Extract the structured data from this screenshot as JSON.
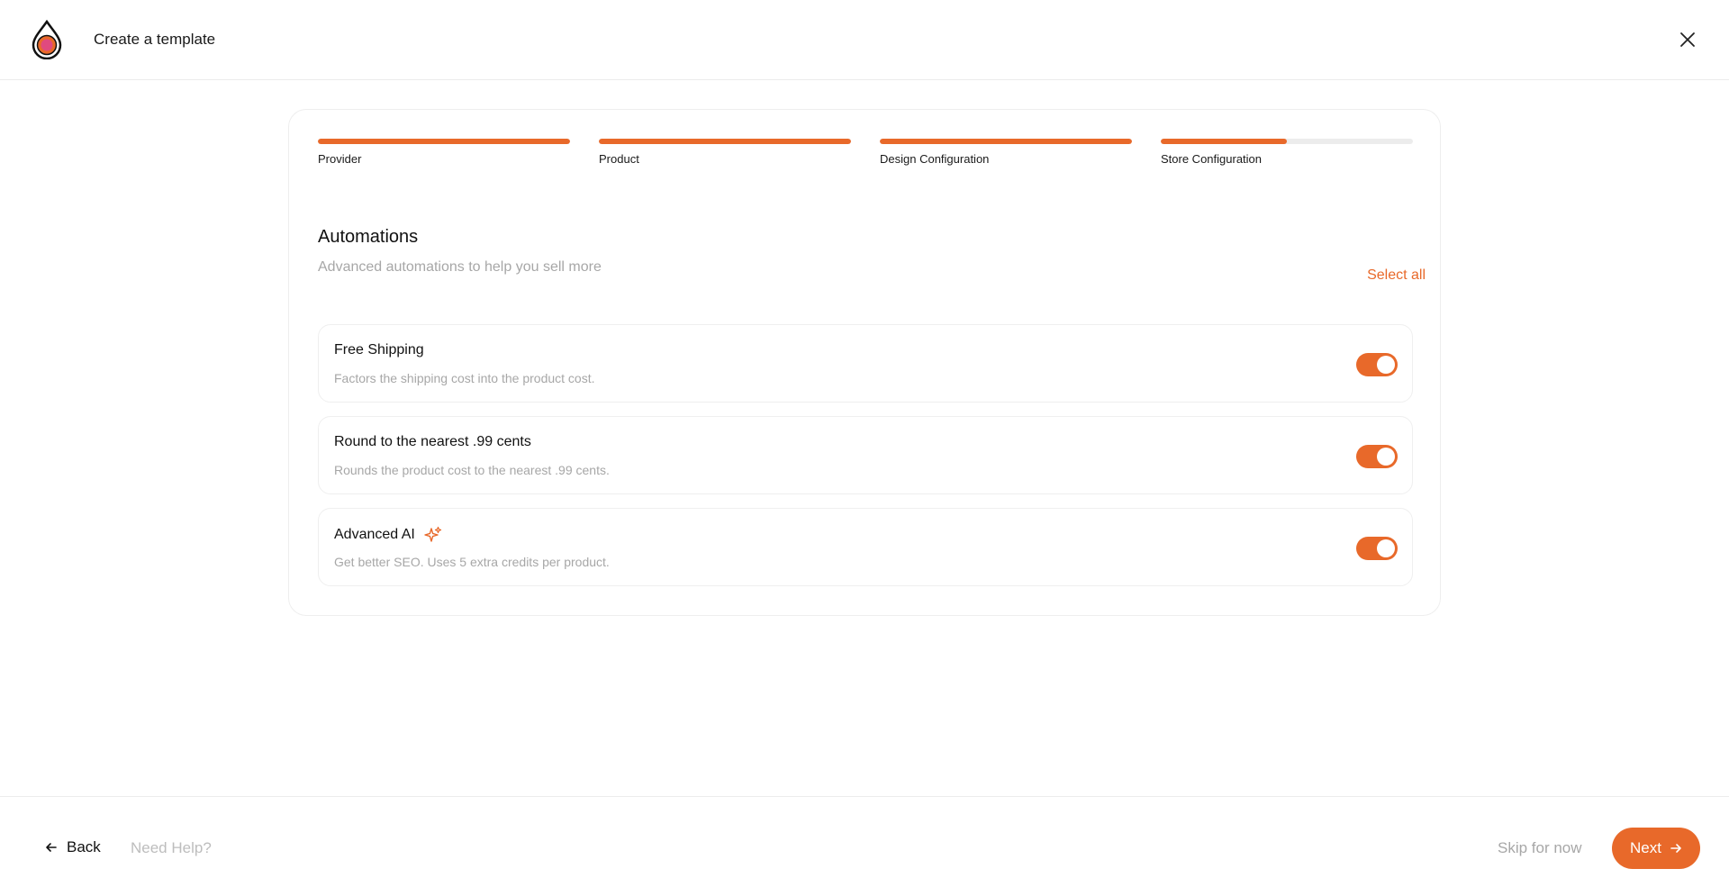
{
  "header": {
    "title": "Create a template",
    "logo_icon": "droplet-logo-icon",
    "close_icon": "close-icon"
  },
  "steps": [
    {
      "label": "Provider",
      "progress": 1.0
    },
    {
      "label": "Product",
      "progress": 1.0
    },
    {
      "label": "Design Configuration",
      "progress": 1.0
    },
    {
      "label": "Store Configuration",
      "progress": 0.5
    }
  ],
  "section": {
    "title": "Automations",
    "subtitle": "Advanced automations to help you sell more",
    "select_all": "Select all"
  },
  "options": [
    {
      "title": "Free Shipping",
      "description": "Factors the shipping cost into the product cost.",
      "enabled": true
    },
    {
      "title": "Round to the nearest .99 cents",
      "description": "Rounds the product cost to the nearest .99 cents.",
      "enabled": true
    },
    {
      "title": "Advanced AI",
      "description": "Get better SEO. Uses 5 extra credits per product.",
      "enabled": true,
      "icon": "sparkle-icon"
    }
  ],
  "footer": {
    "back_label": "Back",
    "help_label": "Need Help?",
    "skip_label": "Skip for now",
    "next_label": "Next"
  },
  "colors": {
    "accent": "#e8692a",
    "muted_text": "#a7a7a7",
    "border": "#eeeeee"
  }
}
